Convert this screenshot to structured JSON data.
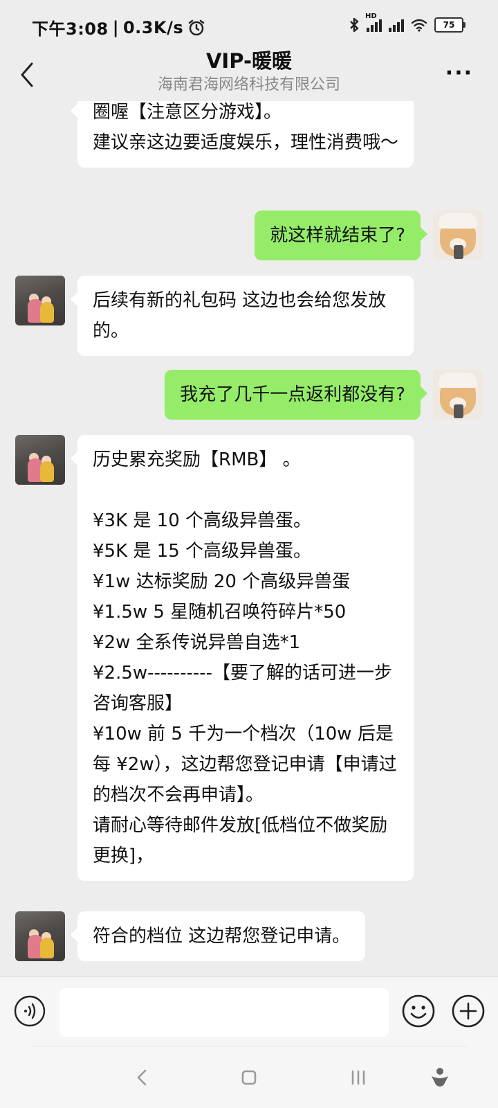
{
  "status_bar": {
    "time": "下午3:08",
    "separator": "|",
    "net_speed": "0.3K/s",
    "battery": "75",
    "hd_label": "HD"
  },
  "header": {
    "title": "VIP-暖暖",
    "subtitle": "海南君海网络科技有限公司"
  },
  "messages": [
    {
      "from": "other",
      "text": "圈喔【注意区分游戏】。\n建议亲这边要适度娱乐，理性消费哦～"
    },
    {
      "from": "me",
      "text": "就这样就结束了?"
    },
    {
      "from": "other",
      "text": "后续有新的礼包码 这边也会给您发放的。"
    },
    {
      "from": "me",
      "text": "我充了几千一点返利都没有?"
    },
    {
      "from": "other",
      "text": "历史累充奖励【RMB】 。\n\n¥3K 是 10 个高级异兽蛋。\n¥5K 是 15 个高级异兽蛋。\n¥1w 达标奖励 20 个高级异兽蛋\n¥1.5w 5 星随机召唤符碎片*50\n¥2w 全系传说异兽自选*1\n¥2.5w----------【要了解的话可进一步咨询客服】\n¥10w 前 5 千为一个档次（10w 后是每 ¥2w），这边帮您登记申请【申请过的档次不会再申请】。\n请耐心等待邮件发放[低档位不做奖励更换]，"
    },
    {
      "from": "other",
      "text": "符合的档位 这边帮您登记申请。"
    }
  ],
  "input": {
    "value": "",
    "placeholder": ""
  },
  "colors": {
    "background": "#ededed",
    "bubble_me": "#95ec69",
    "bubble_other": "#ffffff"
  },
  "icons": [
    "back-icon",
    "more-icon",
    "voice-icon",
    "emoji-icon",
    "plus-icon",
    "nav-back-icon",
    "nav-home-icon",
    "nav-recent-icon",
    "nav-assistant-icon"
  ]
}
